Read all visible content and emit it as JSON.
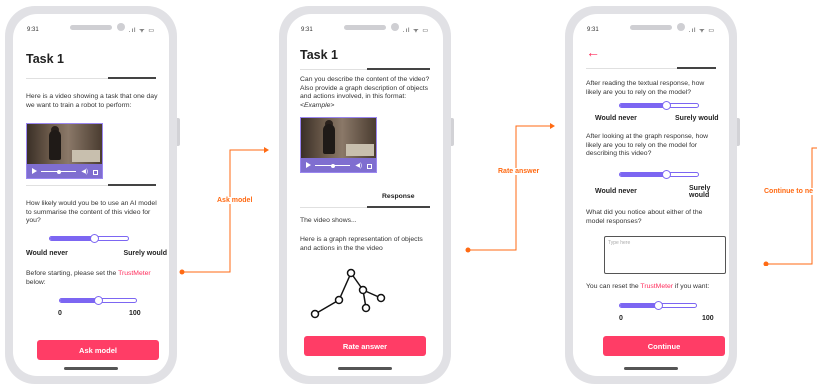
{
  "status_time": "9:31",
  "screen1": {
    "title": "Task 1",
    "intro": "Here is a video showing a task that one day we want to train a robot to perform:",
    "question": "How likely would you be to use an AI model to summarise the content of this video for you?",
    "slider_value": 0.57,
    "label_min": "Would never",
    "label_max": "Surely would",
    "trust_prefix": "Before starting, please set the ",
    "trust_word": "TrustMeter",
    "trust_suffix": " below:",
    "trust_value": 0.5,
    "trust_min": "0",
    "trust_max": "100",
    "button": "Ask model"
  },
  "connector1": {
    "label": "Ask model"
  },
  "screen2": {
    "title": "Task 1",
    "question": "Can you describe the content of the video? Also provide a graph description of objects and actions involved, in this format:",
    "example": "<Example>",
    "tab": "Response",
    "response1": "The video shows...",
    "response2": "Here is a graph representation of objects and actions in the the video",
    "button": "Rate answer"
  },
  "connector2": {
    "label": "Rate answer"
  },
  "screen3": {
    "q1": "After reading the textual response, how likely are you to rely on the model?",
    "slider1_value": 0.6,
    "label_min": "Would never",
    "label_max": "Surely would",
    "q2": "After looking at the graph response, how likely are you to rely on the model for describing this video?",
    "slider2_value": 0.6,
    "q3": "What did you notice about either of the model responses?",
    "placeholder": "Type here",
    "reset_prefix": "You can reset the ",
    "reset_word": "TrustMeter",
    "reset_suffix": " if you want:",
    "trust_value": 0.5,
    "trust_min": "0",
    "trust_max": "100",
    "button": "Continue"
  },
  "connector3": {
    "label": "Continue to ne"
  },
  "colors": {
    "accent": "#ff3d66",
    "slider": "#7c66f2",
    "connector": "#ff6a13"
  }
}
